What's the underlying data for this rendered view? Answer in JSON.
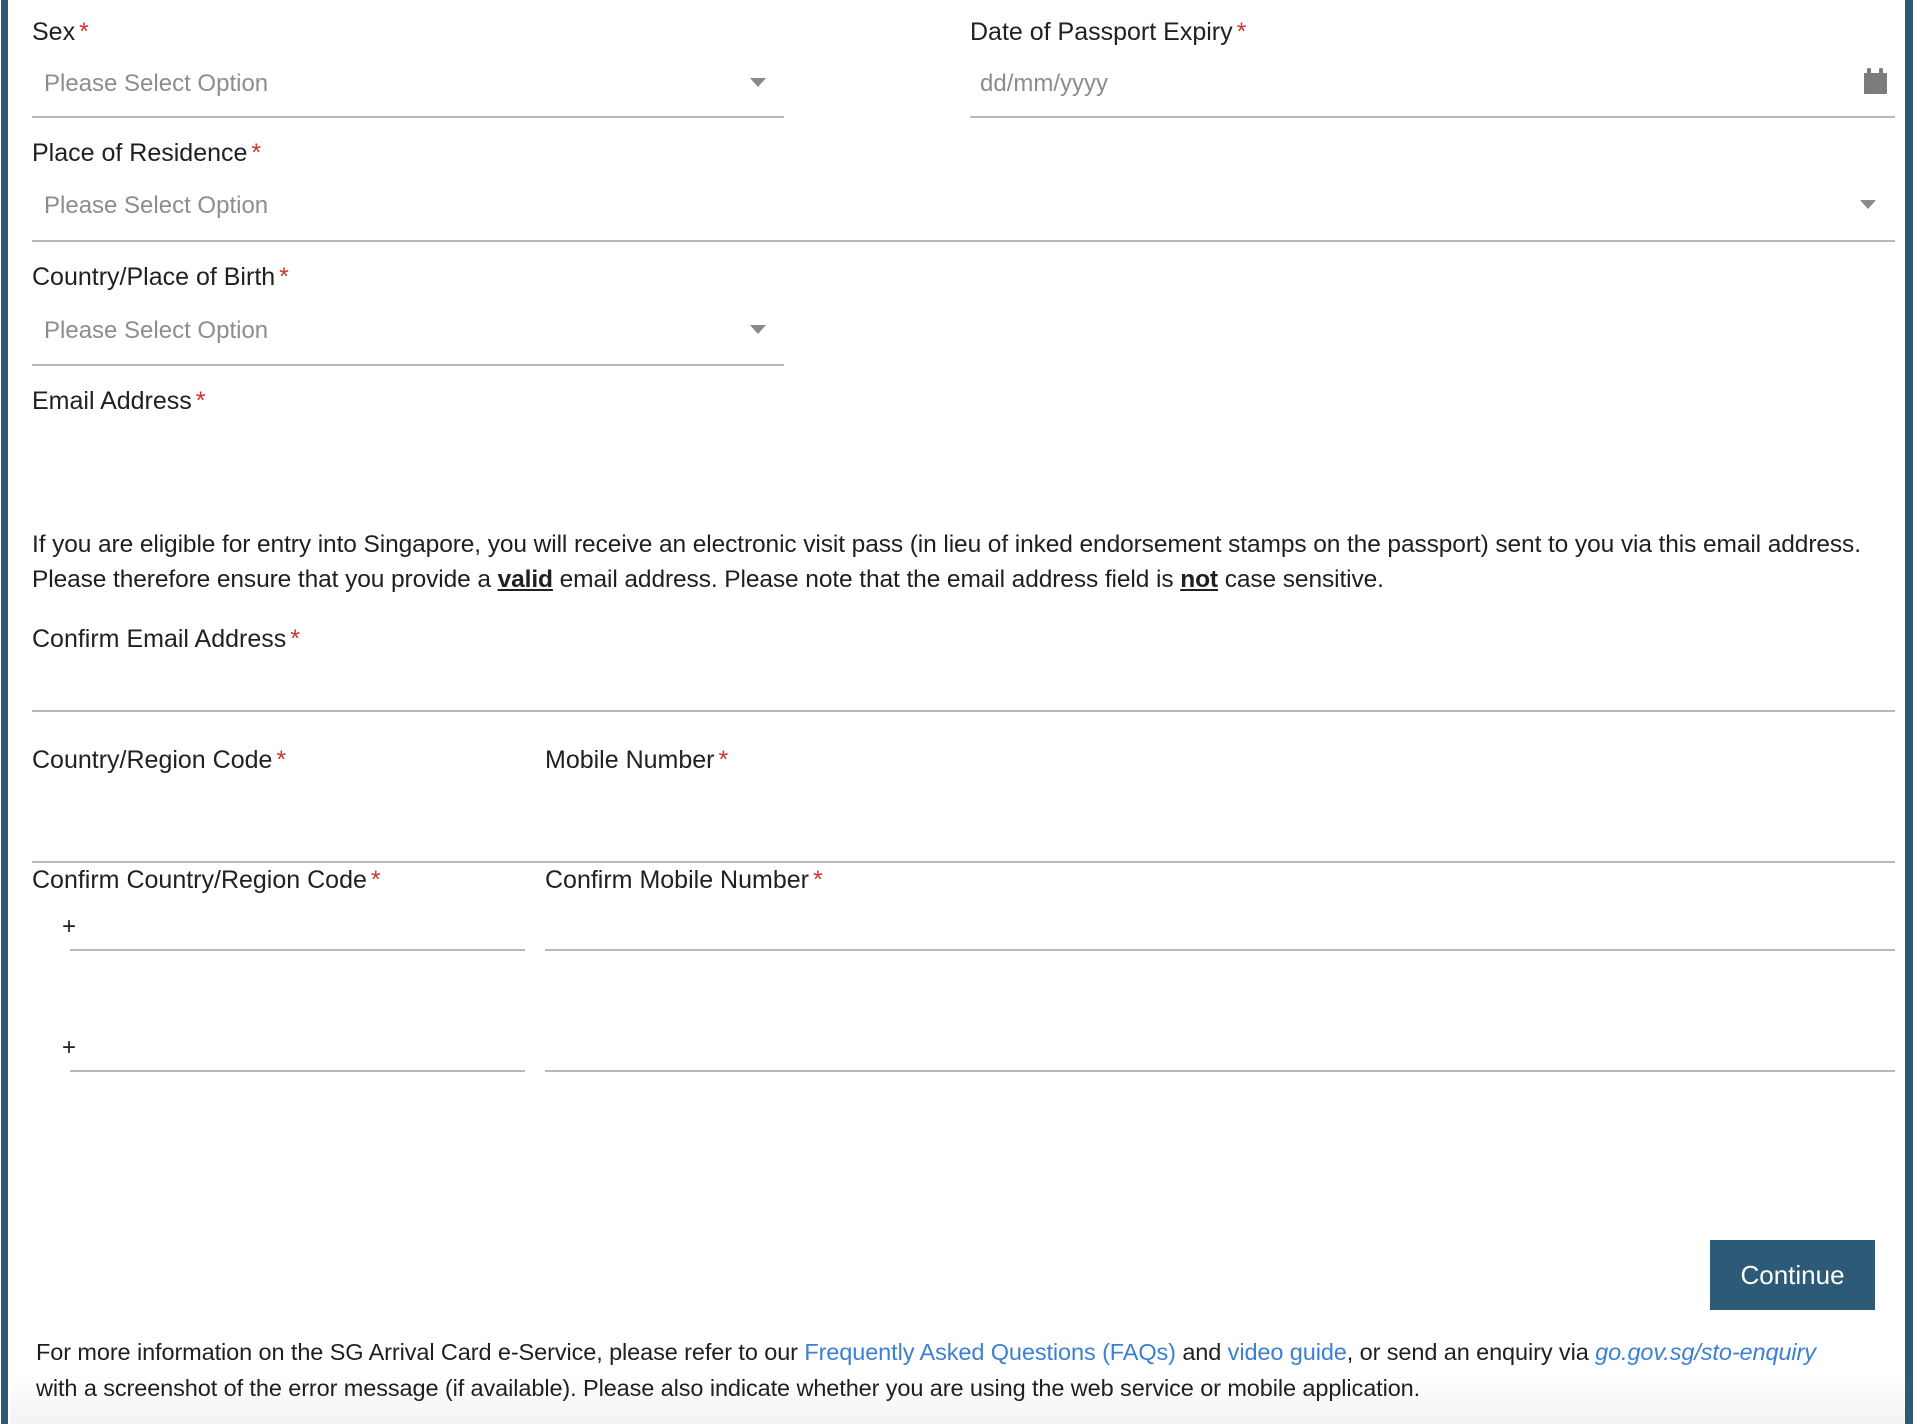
{
  "theme": {
    "accent": "#2d5a77",
    "required_star": "#d0342c",
    "link": "#3d7fd1",
    "underline": "#b9b9b9",
    "placeholder_text": "#8d8d8d"
  },
  "form": {
    "required_marker": "*",
    "fields": {
      "sex": {
        "label": "Sex",
        "placeholder": "Please Select Option",
        "value": "",
        "icon": "chevron-down-icon"
      },
      "passport_expiry": {
        "label": "Date of Passport Expiry",
        "placeholder": "dd/mm/yyyy",
        "value": "",
        "icon": "calendar-icon"
      },
      "place_of_residence": {
        "label": "Place of Residence",
        "placeholder": "Please Select Option",
        "value": "",
        "icon": "chevron-down-icon"
      },
      "country_place_of_birth": {
        "label": "Country/Place of Birth",
        "placeholder": "Please Select Option",
        "value": "",
        "icon": "chevron-down-icon"
      },
      "email": {
        "label": "Email Address",
        "placeholder": "",
        "value": "",
        "help_parts": {
          "p1": "If you are eligible for entry into Singapore, you will receive an electronic visit pass (in lieu of inked endorsement stamps on the passport) sent to you via this email address. Please therefore ensure that you provide a ",
          "emphasis1": "valid",
          "p2": " email address. Please note that the email address field is ",
          "emphasis2": "not",
          "p3": " case sensitive."
        }
      },
      "confirm_email": {
        "label": "Confirm Email Address",
        "placeholder": "",
        "value": ""
      },
      "country_region_code": {
        "label": "Country/Region Code",
        "prefix": "+",
        "placeholder": "",
        "value": ""
      },
      "mobile_number": {
        "label": "Mobile Number",
        "placeholder": "",
        "value": ""
      },
      "confirm_country_region_code": {
        "label": "Confirm Country/Region Code",
        "prefix": "+",
        "placeholder": "",
        "value": ""
      },
      "confirm_mobile_number": {
        "label": "Confirm Mobile Number",
        "placeholder": "",
        "value": ""
      }
    },
    "submit": {
      "label": "Continue"
    }
  },
  "footer": {
    "part1": "For more information on the SG Arrival Card e-Service, please refer to our ",
    "link_faq": "Frequently Asked Questions (FAQs)",
    "part2": " and ",
    "link_video": "video guide",
    "part3": ", or send an enquiry via ",
    "link_enquiry": "go.gov.sg/sto-enquiry",
    "part4": " with a screenshot of the error message (if available). Please also indicate whether you are using the web service or mobile application."
  }
}
